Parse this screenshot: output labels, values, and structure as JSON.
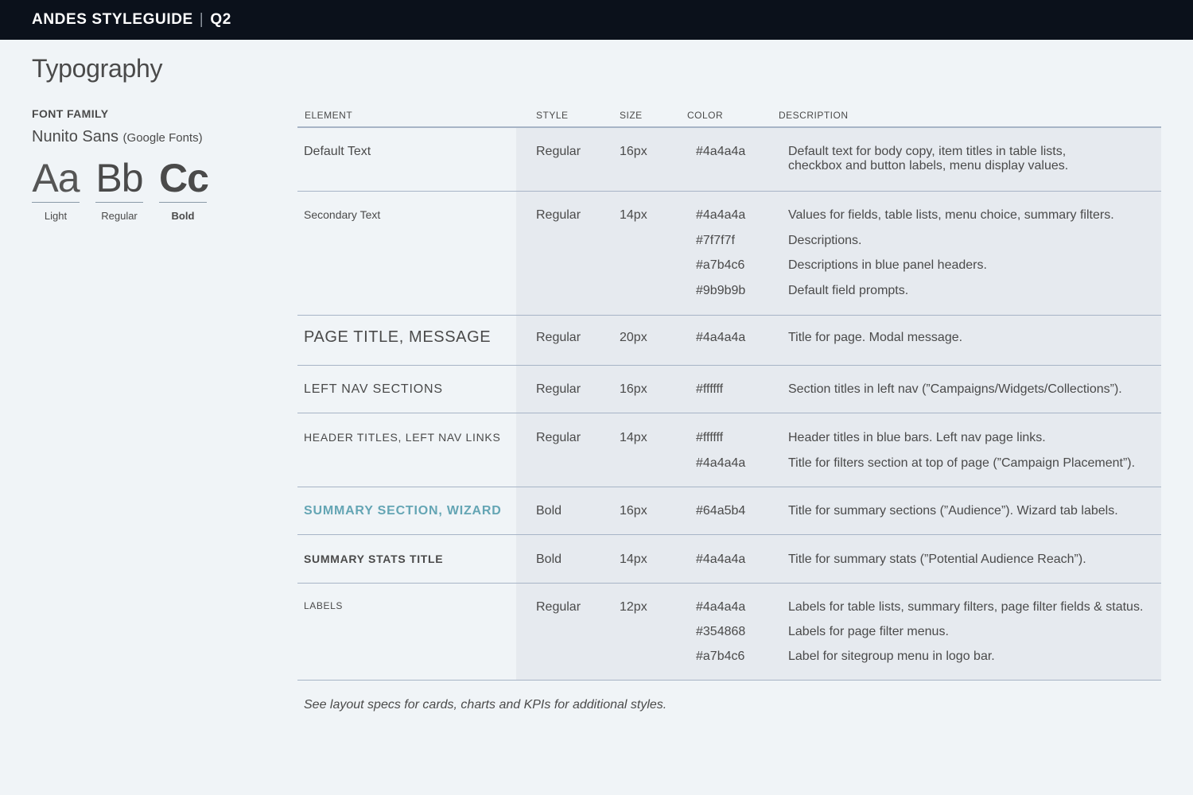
{
  "header": {
    "brand": "ANDES STYLEGUIDE",
    "separator": "|",
    "quarter": "Q2"
  },
  "page_title": "Typography",
  "font_family": {
    "label": "FONT FAMILY",
    "name": "Nunito Sans",
    "source": "(Google Fonts)",
    "samples": [
      {
        "glyph": "Aa",
        "caption": "Light"
      },
      {
        "glyph": "Bb",
        "caption": "Regular"
      },
      {
        "glyph": "Cc",
        "caption": "Bold"
      }
    ]
  },
  "table": {
    "headers": {
      "element": "ELEMENT",
      "style": "STYLE",
      "size": "SIZE",
      "color": "COLOR",
      "description": "DESCRIPTION"
    },
    "rows": [
      {
        "element": "Default Text",
        "style": "Regular",
        "size": "16px",
        "entries": [
          {
            "color": "#4a4a4a",
            "description": "Default text for body copy, item titles in table lists,\ncheckbox and button labels, menu display values."
          }
        ]
      },
      {
        "element": "Secondary Text",
        "style": "Regular",
        "size": "14px",
        "entries": [
          {
            "color": "#4a4a4a",
            "description": "Values for fields, table lists, menu choice, summary filters."
          },
          {
            "color": "#7f7f7f",
            "description": "Descriptions."
          },
          {
            "color": "#a7b4c6",
            "description": "Descriptions in blue panel headers."
          },
          {
            "color": "#9b9b9b",
            "description": "Default field prompts."
          }
        ]
      },
      {
        "element": "PAGE TITLE, MESSAGE",
        "style": "Regular",
        "size": "20px",
        "entries": [
          {
            "color": "#4a4a4a",
            "description": "Title for page. Modal message."
          }
        ]
      },
      {
        "element": "LEFT NAV SECTIONS",
        "style": "Regular",
        "size": "16px",
        "entries": [
          {
            "color": "#ffffff",
            "description": "Section titles in left nav (”Campaigns/Widgets/Collections”)."
          }
        ]
      },
      {
        "element": "HEADER TITLES, LEFT NAV LINKS",
        "style": "Regular",
        "size": "14px",
        "entries": [
          {
            "color": "#ffffff",
            "description": "Header titles in blue bars. Left nav page links."
          },
          {
            "color": "#4a4a4a",
            "description": "Title for filters section at top of page (”Campaign Placement”)."
          }
        ]
      },
      {
        "element": "SUMMARY SECTION, WIZARD",
        "style": "Bold",
        "size": "16px",
        "entries": [
          {
            "color": "#64a5b4",
            "description": "Title for summary sections (”Audience”). Wizard tab labels."
          }
        ]
      },
      {
        "element": "SUMMARY STATS TITLE",
        "style": "Bold",
        "size": "14px",
        "entries": [
          {
            "color": "#4a4a4a",
            "description": "Title for summary stats (”Potential Audience Reach”)."
          }
        ]
      },
      {
        "element": "LABELS",
        "style": "Regular",
        "size": "12px",
        "entries": [
          {
            "color": "#4a4a4a",
            "description": "Labels for table lists, summary filters, page filter fields & status."
          },
          {
            "color": "#354868",
            "description": "Labels for page filter menus."
          },
          {
            "color": "#a7b4c6",
            "description": "Label for sitegroup menu in logo bar."
          }
        ]
      }
    ]
  },
  "footnote": "See layout specs for cards, charts and KPIs for additional styles.",
  "colors": {
    "topbar_bg": "#0b111b",
    "page_bg": "#f0f4f7",
    "shaded_bg": "#e6eaef",
    "rule": "#a7b4c6",
    "accent_teal": "#64a5b4"
  }
}
